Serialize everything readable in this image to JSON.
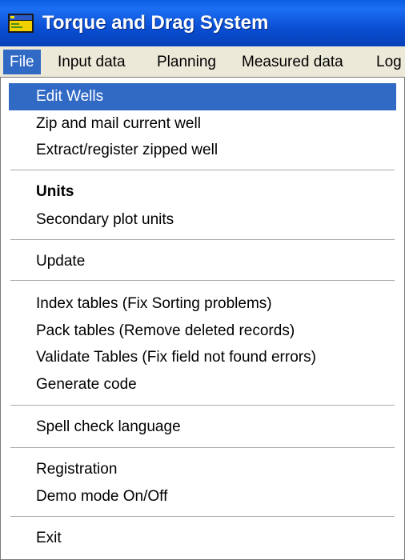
{
  "window": {
    "title": "Torque and Drag System",
    "icon": "app-window-icon"
  },
  "menubar": {
    "items": [
      {
        "label": "File"
      },
      {
        "label": "Input data"
      },
      {
        "label": "Planning"
      },
      {
        "label": "Measured data"
      },
      {
        "label": "Log"
      }
    ]
  },
  "file_menu": {
    "items": [
      {
        "label": "Edit Wells"
      },
      {
        "label": "Zip and mail current well"
      },
      {
        "label": "Extract/register zipped well"
      },
      {
        "label": "Units"
      },
      {
        "label": "Secondary plot units"
      },
      {
        "label": "Update"
      },
      {
        "label": "Index tables (Fix Sorting problems)"
      },
      {
        "label": "Pack tables (Remove deleted records)"
      },
      {
        "label": "Validate Tables (Fix field not found errors)"
      },
      {
        "label": "Generate code"
      },
      {
        "label": "Spell check language"
      },
      {
        "label": "Registration"
      },
      {
        "label": "Demo mode On/Off"
      },
      {
        "label": "Exit"
      }
    ]
  },
  "colors": {
    "titlebar": "#0a4fd4",
    "highlight": "#316ac5",
    "menu_bg": "#ece9d8"
  }
}
